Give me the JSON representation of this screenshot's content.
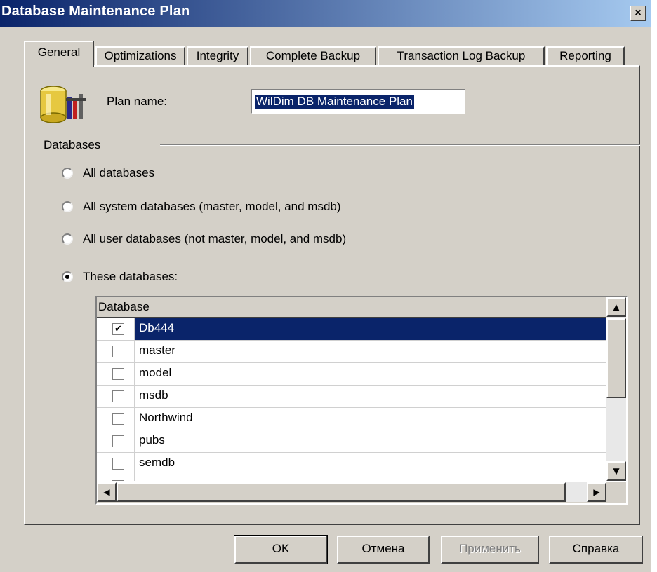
{
  "window": {
    "title": "Database Maintenance Plan",
    "close_glyph": "×"
  },
  "tabs": [
    {
      "label": "General",
      "active": true
    },
    {
      "label": "Optimizations"
    },
    {
      "label": "Integrity"
    },
    {
      "label": "Complete Backup"
    },
    {
      "label": "Transaction Log Backup"
    },
    {
      "label": "Reporting"
    }
  ],
  "plan": {
    "label": "Plan name:",
    "value": "WilDim DB Maintenance Plan",
    "icon": "database-plan-icon"
  },
  "databases": {
    "group_label": "Databases",
    "options": [
      {
        "label": "All databases",
        "checked": false
      },
      {
        "label": "All system databases (master, model, and msdb)",
        "checked": false
      },
      {
        "label": "All user databases (not master, model, and msdb)",
        "checked": false
      },
      {
        "label": "These databases:",
        "checked": true
      }
    ],
    "list": {
      "header": "Database",
      "rows": [
        {
          "name": "Db444",
          "checked": true,
          "selected": true
        },
        {
          "name": "master",
          "checked": false
        },
        {
          "name": "model",
          "checked": false
        },
        {
          "name": "msdb",
          "checked": false
        },
        {
          "name": "Northwind",
          "checked": false
        },
        {
          "name": "pubs",
          "checked": false
        },
        {
          "name": "semdb",
          "checked": false
        }
      ]
    }
  },
  "buttons": {
    "ok": "OK",
    "cancel": "Отмена",
    "apply": "Применить",
    "help": "Справка"
  }
}
